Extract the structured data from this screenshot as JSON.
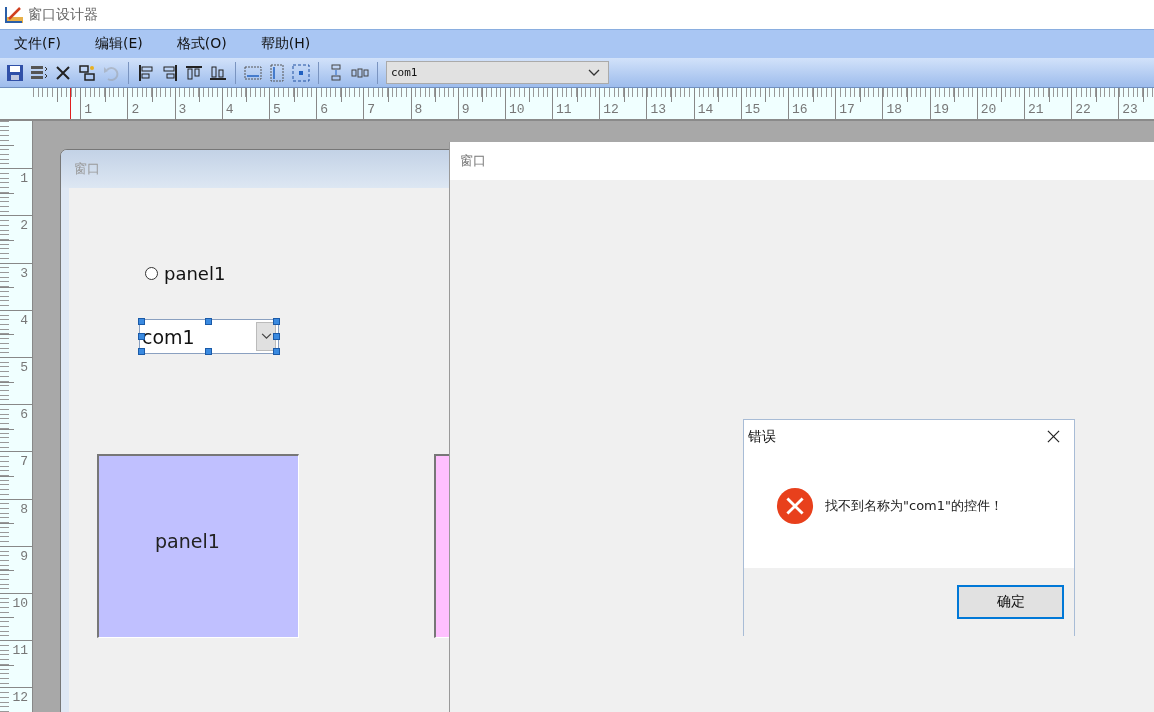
{
  "window": {
    "title": "窗口设计器"
  },
  "menu": [
    {
      "label": "文件(F)"
    },
    {
      "label": "编辑(E)"
    },
    {
      "label": "格式(O)"
    },
    {
      "label": "帮助(H)"
    }
  ],
  "toolbar": {
    "buttons": [
      {
        "kind": "save",
        "disabled": false
      },
      {
        "kind": "list",
        "disabled": false
      },
      {
        "kind": "cut",
        "disabled": false
      },
      {
        "kind": "copy",
        "disabled": false
      },
      {
        "kind": "undo",
        "disabled": true
      },
      {
        "kind": "separator"
      },
      {
        "kind": "align-left",
        "disabled": false
      },
      {
        "kind": "align-right",
        "disabled": false
      },
      {
        "kind": "align-top",
        "disabled": false
      },
      {
        "kind": "align-bottom",
        "disabled": false
      },
      {
        "kind": "separator"
      },
      {
        "kind": "same-width",
        "disabled": false
      },
      {
        "kind": "same-height",
        "disabled": false
      },
      {
        "kind": "same-size",
        "disabled": false
      },
      {
        "kind": "separator"
      },
      {
        "kind": "v-space",
        "disabled": false
      },
      {
        "kind": "h-space",
        "disabled": false
      },
      {
        "kind": "separator"
      }
    ],
    "control_select": {
      "value": "com1"
    }
  },
  "ruler": {
    "horizontal": [
      "1",
      "2",
      "3",
      "4",
      "5",
      "6",
      "7",
      "8",
      "9",
      "10",
      "11",
      "12",
      "13",
      "14",
      "15",
      "16",
      "17",
      "18",
      "19",
      "20",
      "21",
      "22",
      "23"
    ],
    "vertical": [
      "1",
      "2",
      "3",
      "4",
      "5",
      "6",
      "7",
      "8",
      "9",
      "10",
      "11",
      "12"
    ]
  },
  "design_window": {
    "title": "窗口",
    "controls": [
      {
        "kind": "radio",
        "label": "panel1",
        "checked": false
      },
      {
        "kind": "combo",
        "value": "com1",
        "selected": true
      },
      {
        "kind": "panel",
        "label": "panel1",
        "color": "#c0c0ff"
      },
      {
        "kind": "panel",
        "color": "#ffc0ff"
      }
    ]
  },
  "preview_window": {
    "title": "窗口"
  },
  "dialog": {
    "title": "错误",
    "message": "找不到名称为\"com1\"的控件！",
    "buttons": [
      {
        "label": "确定",
        "focused": true
      }
    ]
  }
}
